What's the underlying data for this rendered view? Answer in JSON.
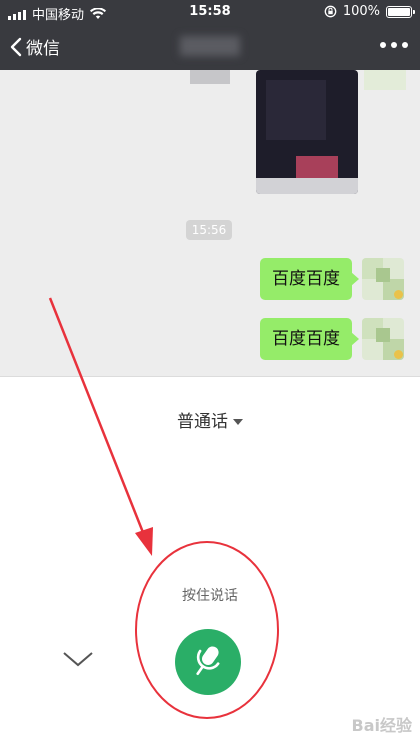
{
  "status_bar": {
    "carrier": "中国移动",
    "time": "15:58",
    "battery": "100%"
  },
  "nav": {
    "back_label": "微信"
  },
  "chat": {
    "timestamp": "15:56",
    "messages": [
      {
        "text": "百度百度",
        "from": "me"
      },
      {
        "text": "百度百度",
        "from": "me"
      }
    ]
  },
  "voice_panel": {
    "language": "普通话",
    "hint": "按住说话"
  },
  "watermark": "Bai经验",
  "colors": {
    "nav_bg": "#393a3f",
    "bubble_green": "#95ec69",
    "mic_green": "#2aae67",
    "annotation_red": "#e8323c"
  }
}
